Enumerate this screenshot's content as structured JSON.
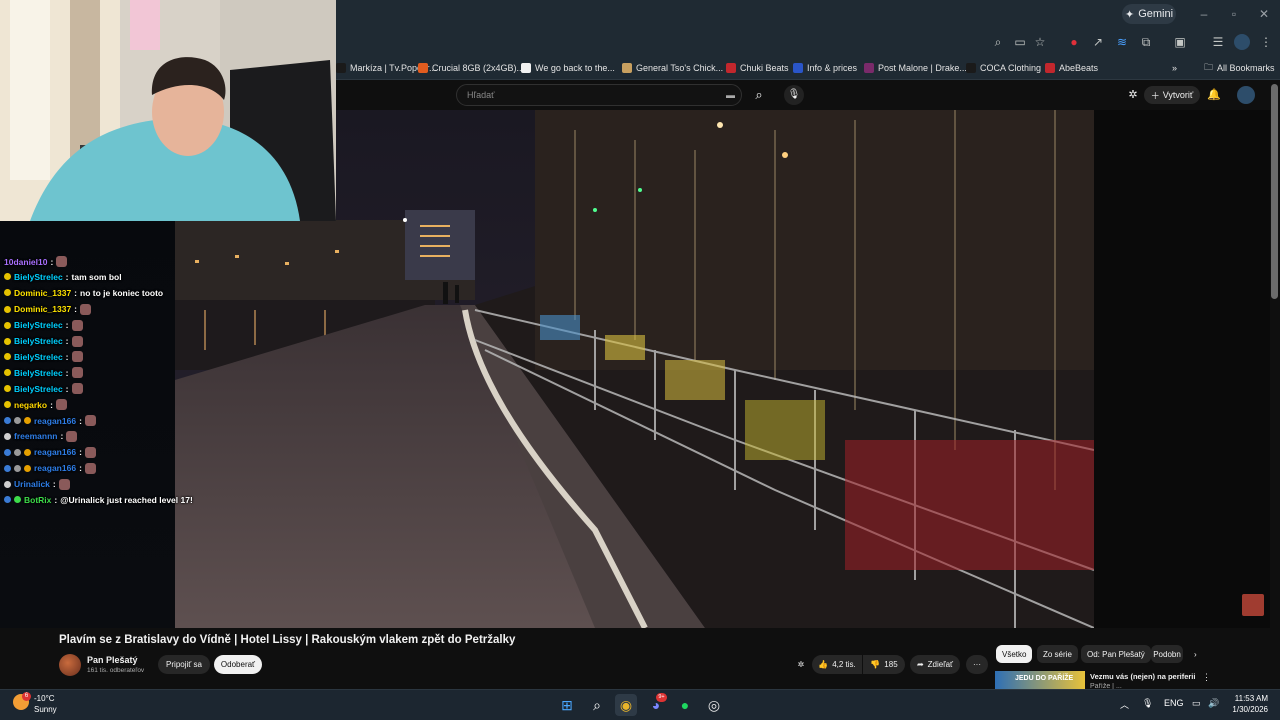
{
  "browser": {
    "gemini_label": "Gemini",
    "bookmarks": [
      {
        "label": "Markíza | Tv.Popcor...",
        "color": "#1a1a1a"
      },
      {
        "label": "Crucial 8GB (2x4GB)...",
        "color": "#e25c1f"
      },
      {
        "label": "We go back to the...",
        "color": "#f1f1f1"
      },
      {
        "label": "General Tso's Chick...",
        "color": "#c8a060"
      },
      {
        "label": "Chuki Beats",
        "color": "#c2272d"
      },
      {
        "label": "Info & prices",
        "color": "#2a55c8"
      },
      {
        "label": "Post Malone | Drake...",
        "color": "#7a2a6a"
      },
      {
        "label": "COCA Clothing",
        "color": "#1a1a1a"
      },
      {
        "label": "AbeBeats",
        "color": "#c2272d"
      }
    ],
    "all_bookmarks": "All Bookmarks",
    "more": "»"
  },
  "youtube": {
    "search_placeholder": "Hľadať",
    "create_label": "Vytvoriť",
    "video_title": "Plavím se z Bratislavy do Vídně | Hotel Lissy | Rakouským vlakem zpět do Petržalky",
    "channel_name": "Pan Plešatý",
    "subscribers": "161 tis. odberateľov",
    "join_label": "Pripojiť sa",
    "unsubscribe_label": "Odoberať",
    "likes": "4,2 tis.",
    "dislikes": "185",
    "share_label": "Zdieľať",
    "more_label": "···",
    "chips": [
      "Všetko",
      "Zo série",
      "Od: Pan Plešatý",
      "Podobn"
    ],
    "rec_title": "Vezmu vás (nejen) na periferii",
    "rec_subtitle": "Paříže | ...",
    "thumb_text": "JEDU DO PAŘÍŽE"
  },
  "chat": [
    {
      "user": "10daniel10",
      "color": "#a970ff",
      "message": "",
      "emote": true,
      "badges": []
    },
    {
      "user": "BielyStrelec",
      "color": "#00d0ff",
      "message": "tam som bol",
      "emote": false,
      "badges": [
        "#e6c200"
      ]
    },
    {
      "user": "Dominic_1337",
      "color": "#ffe400",
      "message": "no to je koniec tooto",
      "emote": false,
      "badges": [
        "#e6c200"
      ]
    },
    {
      "user": "Dominic_1337",
      "color": "#ffe400",
      "message": "",
      "emote": true,
      "badges": [
        "#e6c200"
      ]
    },
    {
      "user": "BielyStrelec",
      "color": "#00d0ff",
      "message": "",
      "emote": true,
      "badges": [
        "#e6c200"
      ]
    },
    {
      "user": "BielyStrelec",
      "color": "#00d0ff",
      "message": "",
      "emote": true,
      "badges": [
        "#e6c200"
      ]
    },
    {
      "user": "BielyStrelec",
      "color": "#00d0ff",
      "message": "",
      "emote": true,
      "badges": [
        "#e6c200"
      ]
    },
    {
      "user": "BielyStrelec",
      "color": "#00d0ff",
      "message": "",
      "emote": true,
      "badges": [
        "#e6c200"
      ]
    },
    {
      "user": "BielyStrelec",
      "color": "#00d0ff",
      "message": "",
      "emote": true,
      "badges": [
        "#e6c200"
      ]
    },
    {
      "user": "negarko",
      "color": "#ffd700",
      "message": "",
      "emote": true,
      "badges": [
        "#e6c200"
      ]
    },
    {
      "user": "reagan166",
      "color": "#2e7ee8",
      "message": "",
      "emote": true,
      "badges": [
        "#3a7bd5",
        "#9a9a9a",
        "#e6a000"
      ]
    },
    {
      "user": "freemannn",
      "color": "#2e7ee8",
      "message": "",
      "emote": true,
      "badges": [
        "#cfcfcf"
      ]
    },
    {
      "user": "reagan166",
      "color": "#2e7ee8",
      "message": "",
      "emote": true,
      "badges": [
        "#3a7bd5",
        "#9a9a9a",
        "#e6a000"
      ]
    },
    {
      "user": "reagan166",
      "color": "#2e7ee8",
      "message": "",
      "emote": true,
      "badges": [
        "#3a7bd5",
        "#9a9a9a",
        "#e6a000"
      ]
    },
    {
      "user": "Urinalick",
      "color": "#2e7ee8",
      "message": "",
      "emote": true,
      "badges": [
        "#cfcfcf"
      ]
    },
    {
      "user": "BotRix",
      "color": "#3ddc4a",
      "message": "@Urinalick just reached level 17!",
      "emote": false,
      "badges": [
        "#3a7bd5",
        "#3ddc4a"
      ]
    }
  ],
  "taskbar": {
    "temperature": "-10°C",
    "condition": "Sunny",
    "weather_badge": "6",
    "language": "ENG",
    "time": "11:53 AM",
    "date": "1/30/2026",
    "discord_badge": "9+"
  }
}
